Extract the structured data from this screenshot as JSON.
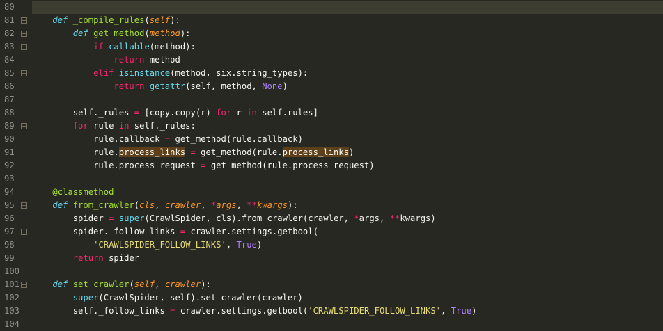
{
  "editor": {
    "lines": [
      {
        "num": "80",
        "fold": false,
        "indent": "",
        "tokens": []
      },
      {
        "num": "81",
        "fold": true,
        "indent": "    ",
        "tokens": [
          [
            "kw",
            "def"
          ],
          [
            "p",
            " "
          ],
          [
            "fn",
            "_compile_rules"
          ],
          [
            "p",
            "("
          ],
          [
            "self",
            "self"
          ],
          [
            "p",
            "):"
          ]
        ]
      },
      {
        "num": "82",
        "fold": true,
        "indent": "        ",
        "tokens": [
          [
            "kw",
            "def"
          ],
          [
            "p",
            " "
          ],
          [
            "fn",
            "get_method"
          ],
          [
            "p",
            "("
          ],
          [
            "self",
            "method"
          ],
          [
            "p",
            "):"
          ]
        ]
      },
      {
        "num": "83",
        "fold": true,
        "indent": "            ",
        "tokens": [
          [
            "ctl",
            "if"
          ],
          [
            "p",
            " "
          ],
          [
            "bi",
            "callable"
          ],
          [
            "p",
            "(method):"
          ]
        ]
      },
      {
        "num": "84",
        "fold": false,
        "indent": "                ",
        "tokens": [
          [
            "ctl",
            "return"
          ],
          [
            "p",
            " method"
          ]
        ]
      },
      {
        "num": "85",
        "fold": true,
        "indent": "            ",
        "tokens": [
          [
            "ctl",
            "elif"
          ],
          [
            "p",
            " "
          ],
          [
            "bi",
            "isinstance"
          ],
          [
            "p",
            "(method, six.string_types):"
          ]
        ]
      },
      {
        "num": "86",
        "fold": false,
        "indent": "                ",
        "tokens": [
          [
            "ctl",
            "return"
          ],
          [
            "p",
            " "
          ],
          [
            "bi",
            "getattr"
          ],
          [
            "p",
            "(self, method, "
          ],
          [
            "const",
            "None"
          ],
          [
            "p",
            ")"
          ]
        ]
      },
      {
        "num": "87",
        "fold": false,
        "indent": "",
        "tokens": []
      },
      {
        "num": "88",
        "fold": false,
        "indent": "        ",
        "tokens": [
          [
            "p",
            "self._rules "
          ],
          [
            "op",
            "="
          ],
          [
            "p",
            " [copy.copy(r) "
          ],
          [
            "ctl",
            "for"
          ],
          [
            "p",
            " r "
          ],
          [
            "ctl",
            "in"
          ],
          [
            "p",
            " self.rules]"
          ]
        ]
      },
      {
        "num": "89",
        "fold": true,
        "indent": "        ",
        "tokens": [
          [
            "ctl",
            "for"
          ],
          [
            "p",
            " rule "
          ],
          [
            "ctl",
            "in"
          ],
          [
            "p",
            " self._rules:"
          ]
        ]
      },
      {
        "num": "90",
        "fold": false,
        "indent": "            ",
        "tokens": [
          [
            "p",
            "rule.callback "
          ],
          [
            "op",
            "="
          ],
          [
            "p",
            " get_method(rule.callback)"
          ]
        ]
      },
      {
        "num": "91",
        "fold": false,
        "indent": "            ",
        "tokens": [
          [
            "p",
            "rule."
          ],
          [
            "hl",
            "process_links"
          ],
          [
            "p",
            " "
          ],
          [
            "op",
            "="
          ],
          [
            "p",
            " get_method(rule."
          ],
          [
            "hl",
            "process_links"
          ],
          [
            "p",
            ")"
          ]
        ]
      },
      {
        "num": "92",
        "fold": false,
        "indent": "            ",
        "tokens": [
          [
            "p",
            "rule.process_request "
          ],
          [
            "op",
            "="
          ],
          [
            "p",
            " get_method(rule.process_request)"
          ]
        ]
      },
      {
        "num": "93",
        "fold": false,
        "indent": "",
        "tokens": []
      },
      {
        "num": "94",
        "fold": false,
        "indent": "    ",
        "tokens": [
          [
            "fn",
            "@classmethod"
          ]
        ]
      },
      {
        "num": "95",
        "fold": true,
        "indent": "    ",
        "tokens": [
          [
            "kw",
            "def"
          ],
          [
            "p",
            " "
          ],
          [
            "fn",
            "from_crawler"
          ],
          [
            "p",
            "("
          ],
          [
            "self",
            "cls"
          ],
          [
            "p",
            ", "
          ],
          [
            "self",
            "crawler"
          ],
          [
            "p",
            ", "
          ],
          [
            "op",
            "*"
          ],
          [
            "self",
            "args"
          ],
          [
            "p",
            ", "
          ],
          [
            "op",
            "**"
          ],
          [
            "self",
            "kwargs"
          ],
          [
            "p",
            "):"
          ]
        ]
      },
      {
        "num": "96",
        "fold": false,
        "indent": "        ",
        "tokens": [
          [
            "p",
            "spider "
          ],
          [
            "op",
            "="
          ],
          [
            "p",
            " "
          ],
          [
            "bi",
            "super"
          ],
          [
            "p",
            "(CrawlSpider, cls).from_crawler(crawler, "
          ],
          [
            "op",
            "*"
          ],
          [
            "p",
            "args, "
          ],
          [
            "op",
            "**"
          ],
          [
            "p",
            "kwargs)"
          ]
        ]
      },
      {
        "num": "97",
        "fold": true,
        "indent": "        ",
        "tokens": [
          [
            "p",
            "spider._follow_links "
          ],
          [
            "op",
            "="
          ],
          [
            "p",
            " crawler.settings.getbool("
          ]
        ]
      },
      {
        "num": "98",
        "fold": false,
        "indent": "            ",
        "tokens": [
          [
            "str",
            "'CRAWLSPIDER_FOLLOW_LINKS'"
          ],
          [
            "p",
            ", "
          ],
          [
            "const",
            "True"
          ],
          [
            "p",
            ")"
          ]
        ]
      },
      {
        "num": "99",
        "fold": false,
        "indent": "        ",
        "tokens": [
          [
            "ctl",
            "return"
          ],
          [
            "p",
            " spider"
          ]
        ]
      },
      {
        "num": "100",
        "fold": false,
        "indent": "",
        "tokens": []
      },
      {
        "num": "101",
        "fold": true,
        "indent": "    ",
        "tokens": [
          [
            "kw",
            "def"
          ],
          [
            "p",
            " "
          ],
          [
            "fn",
            "set_crawler"
          ],
          [
            "p",
            "("
          ],
          [
            "self",
            "self"
          ],
          [
            "p",
            ", "
          ],
          [
            "self",
            "crawler"
          ],
          [
            "p",
            "):"
          ]
        ]
      },
      {
        "num": "102",
        "fold": false,
        "indent": "        ",
        "tokens": [
          [
            "bi",
            "super"
          ],
          [
            "p",
            "(CrawlSpider, self).set_crawler(crawler)"
          ]
        ]
      },
      {
        "num": "103",
        "fold": false,
        "indent": "        ",
        "tokens": [
          [
            "p",
            "self._follow_links "
          ],
          [
            "op",
            "="
          ],
          [
            "p",
            " crawler.settings.getbool("
          ],
          [
            "str",
            "'CRAWLSPIDER_FOLLOW_LINKS'"
          ],
          [
            "p",
            ", "
          ],
          [
            "const",
            "True"
          ],
          [
            "p",
            ")"
          ]
        ]
      },
      {
        "num": "104",
        "fold": false,
        "indent": "",
        "tokens": []
      }
    ]
  }
}
